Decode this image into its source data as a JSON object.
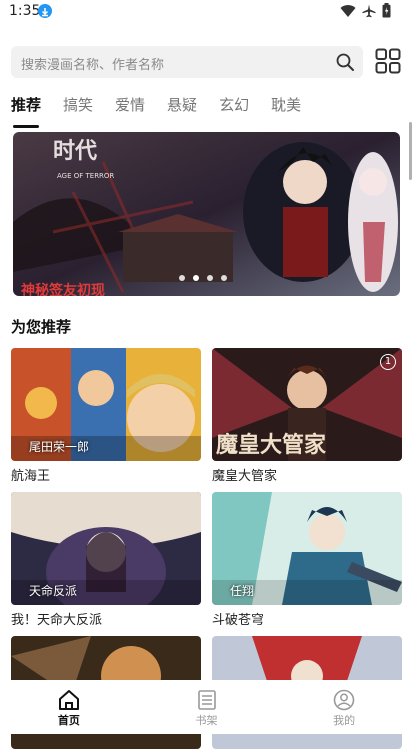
{
  "status": {
    "time": "1:35",
    "download_badge": "download-icon",
    "icons": [
      "wifi-icon",
      "airplane-icon",
      "battery-icon"
    ]
  },
  "search": {
    "placeholder": "搜索漫画名称、作者名称",
    "icon": "search-icon"
  },
  "grid_button": {
    "icon": "grid-icon"
  },
  "tabs": [
    {
      "label": "推荐",
      "active": true
    },
    {
      "label": "搞笑"
    },
    {
      "label": "爱情"
    },
    {
      "label": "悬疑"
    },
    {
      "label": "玄幻"
    },
    {
      "label": "耽美"
    }
  ],
  "banner": {
    "title_text": "时代",
    "subtitle_text": "AGE OF TERROR",
    "bottom_text": "神秘签友初现",
    "dots": 4,
    "active_dot": 2
  },
  "section": {
    "title": "为您推荐"
  },
  "cards": [
    {
      "title": "航海王",
      "tag": "尾田荣一郎",
      "colors": [
        "#c8532a",
        "#f2b84b",
        "#3a6fb0"
      ]
    },
    {
      "title": "魔皇大管家",
      "tag": "",
      "badge": "1",
      "cover_text": "魔皇大管家",
      "colors": [
        "#5a2a2a",
        "#c87a3c",
        "#1a1a1a"
      ]
    },
    {
      "title": "我！天命大反派",
      "tag": "天命反派",
      "colors": [
        "#2d2a44",
        "#a48fc2",
        "#e6dccf"
      ]
    },
    {
      "title": "斗破苍穹",
      "tag": "任翔",
      "colors": [
        "#2e6a6a",
        "#7fc7c0",
        "#1c3550"
      ]
    },
    {
      "title": "",
      "tag": "",
      "colors": [
        "#3a2a1a",
        "#d09050",
        "#7a5a3a"
      ]
    },
    {
      "title": "",
      "tag": "",
      "colors": [
        "#c0c8d8",
        "#c03030",
        "#f0e0d0"
      ]
    }
  ],
  "nav": [
    {
      "label": "首页",
      "icon": "home-icon",
      "active": true
    },
    {
      "label": "书架",
      "icon": "bookshelf-icon"
    },
    {
      "label": "我的",
      "icon": "profile-icon"
    }
  ]
}
